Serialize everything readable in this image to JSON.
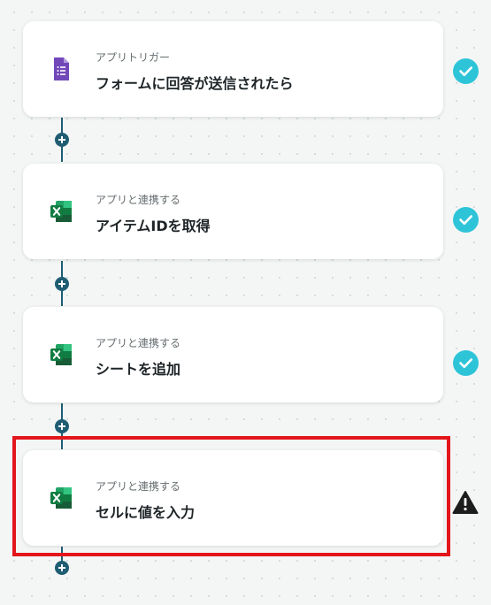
{
  "flow": {
    "steps": [
      {
        "subtitle": "アプリトリガー",
        "title": "フォームに回答が送信されたら",
        "app_icon": "google-forms-icon",
        "status": "complete",
        "status_icon": "check-circle-icon"
      },
      {
        "subtitle": "アプリと連携する",
        "title": "アイテムIDを取得",
        "app_icon": "excel-icon",
        "status": "complete",
        "status_icon": "check-circle-icon"
      },
      {
        "subtitle": "アプリと連携する",
        "title": "シートを追加",
        "app_icon": "excel-icon",
        "status": "complete",
        "status_icon": "check-circle-icon"
      },
      {
        "subtitle": "アプリと連携する",
        "title": "セルに値を入力",
        "app_icon": "excel-icon",
        "status": "warning",
        "status_icon": "warning-triangle-icon",
        "highlighted": true
      }
    ],
    "add_step_icon": "plus-icon"
  },
  "colors": {
    "connector": "#1f5d73",
    "check": "#2ec4d8",
    "highlight": "#e3161c",
    "forms_purple": "#7248b9",
    "excel_green": "#107c41"
  }
}
